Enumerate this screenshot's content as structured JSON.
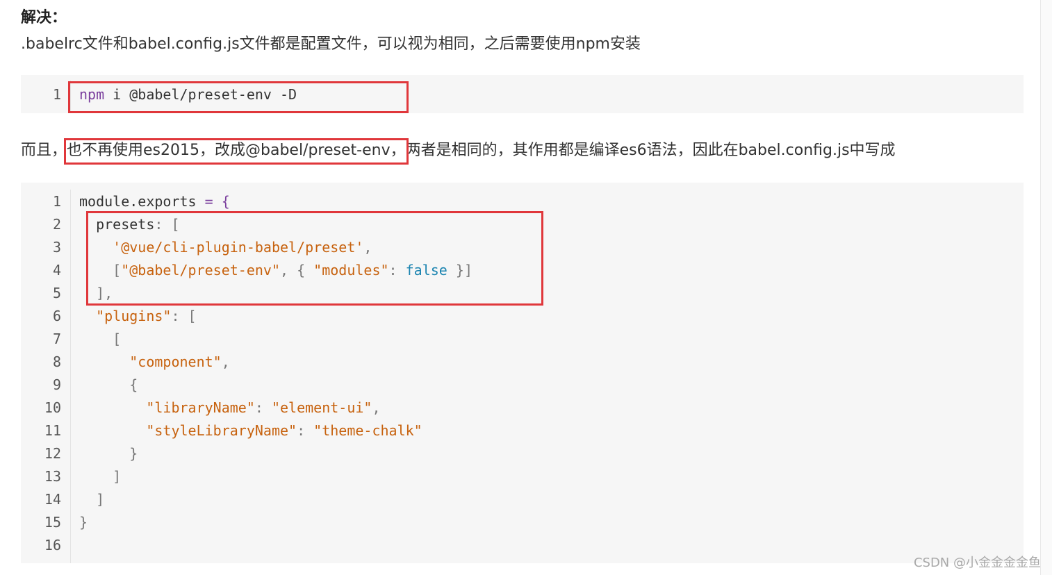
{
  "heading": "解决：",
  "paragraph1": ".babelrc文件和babel.config.js文件都是配置文件，可以视为相同，之后需要使用npm安装",
  "code1": {
    "line_numbers": [
      "1"
    ],
    "command": "npm",
    "args": " i @babel/preset-env -D"
  },
  "paragraph2": {
    "before": "而且，",
    "highlight": "也不再使用es2015，改成@babel/preset-env，",
    "after": "两者是相同的，其作用都是编译es6语法，因此在babel.config.js中写成"
  },
  "code2": {
    "line_numbers": [
      "1",
      "2",
      "3",
      "4",
      "5",
      "6",
      "7",
      "8",
      "9",
      "10",
      "11",
      "12",
      "13",
      "14",
      "15",
      "16"
    ],
    "l1_a": "module.exports ",
    "l1_b": "= {",
    "l2_a": "  presets",
    "l2_b": ": [",
    "l3_a": "    '@vue/cli-plugin-babel/preset'",
    "l3_b": ",",
    "l4_a": "    [",
    "l4_b": "\"@babel/preset-env\"",
    "l4_c": ", { ",
    "l4_d": "\"modules\"",
    "l4_e": ": ",
    "l4_f": "false",
    "l4_g": " }]",
    "l5": "  ],",
    "l6_a": "  \"plugins\"",
    "l6_b": ": [",
    "l7": "    [",
    "l8_a": "      \"component\"",
    "l8_b": ",",
    "l9": "      {",
    "l10_a": "        \"libraryName\"",
    "l10_b": ": ",
    "l10_c": "\"element-ui\"",
    "l10_d": ",",
    "l11_a": "        \"styleLibraryName\"",
    "l11_b": ": ",
    "l11_c": "\"theme-chalk\"",
    "l12": "      }",
    "l13": "    ]",
    "l14": "  ]",
    "l15": "}",
    "l16": ""
  },
  "watermark": "CSDN @小金金金金鱼",
  "colors": {
    "highlight_box": "#e0373b",
    "code_bg": "#f6f6f6",
    "keyword": "#7a3e9d",
    "string": "#c7620e",
    "boolean": "#1b84b0"
  }
}
